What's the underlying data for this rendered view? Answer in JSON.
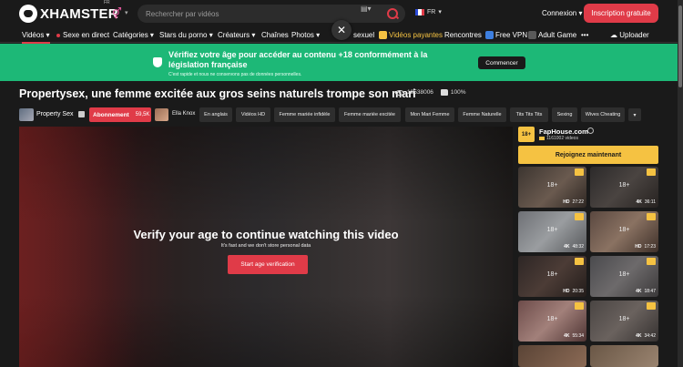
{
  "header": {
    "logo_text": "XHAMSTER",
    "logo_region": "FR",
    "search_placeholder": "Rechercher par vidéos",
    "language": "FR",
    "login": "Connexion",
    "signup": "Inscription gratuite"
  },
  "nav": {
    "items": [
      {
        "label": "Vidéos"
      },
      {
        "label": "Sexe en direct"
      },
      {
        "label": "Catégories"
      },
      {
        "label": "Stars du porno"
      },
      {
        "label": "Créateurs"
      },
      {
        "label": "Chaînes"
      },
      {
        "label": "Photos"
      },
      {
        "label": "sexuel"
      },
      {
        "label": "Vidéos payantes"
      },
      {
        "label": "Rencontres"
      },
      {
        "label": "Free VPN"
      },
      {
        "label": "Adult Game"
      },
      {
        "label": "Uploader"
      }
    ]
  },
  "banner": {
    "title": "Vérifiez votre âge pour accéder au contenu +18 conformément à la législation française",
    "subtitle": "C'est rapide et nous ne conservons pas de données personnelles.",
    "button": "Commencer"
  },
  "video": {
    "title": "Propertysex, une femme excitée aux gros seins naturels trompe son mari",
    "views": "19538006",
    "rating": "100%",
    "channel": "Property Sex",
    "subscribe": "Abonnement",
    "subscribers": "59,5K",
    "model": "Ella Knox",
    "tags": [
      "En anglais",
      "Vidéos HD",
      "Femme mariée infidèle",
      "Femme mariée excitée",
      "Mon Mari Femme",
      "Femme Naturelle",
      "Tits Tits Tits",
      "Sexing",
      "Wives Cheating"
    ],
    "overlay_title": "Verify your age to continue watching this video",
    "overlay_sub": "It's fast and we don't store personal data",
    "overlay_button": "Start age verification"
  },
  "sidebar": {
    "logo": "18+",
    "name": "FapHouse.com",
    "video_count": "1161002",
    "videos_label": "videos",
    "join": "Rejoignez maintenant",
    "thumbs": [
      {
        "label": "18+",
        "quality": "HD",
        "duration": "27:22"
      },
      {
        "label": "18+",
        "quality": "4K",
        "duration": "36:11"
      },
      {
        "label": "18+",
        "quality": "4K",
        "duration": "48:32"
      },
      {
        "label": "18+",
        "quality": "HD",
        "duration": "17:23"
      },
      {
        "label": "18+",
        "quality": "HD",
        "duration": "20:35"
      },
      {
        "label": "18+",
        "quality": "4K",
        "duration": "18:47"
      },
      {
        "label": "18+",
        "quality": "4K",
        "duration": "55:34"
      },
      {
        "label": "18+",
        "quality": "4K",
        "duration": "34:42"
      }
    ]
  },
  "colors": {
    "accent": "#e03b48",
    "banner": "#1db877",
    "gold": "#f5c242",
    "background": "#1a1a1a"
  }
}
